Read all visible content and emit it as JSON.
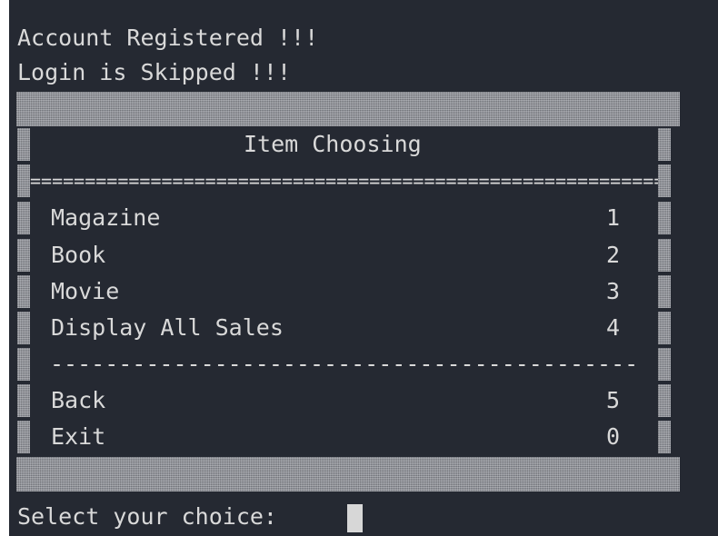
{
  "terminal": {
    "status_lines": [
      "Account Registered !!!",
      "Login is Skipped !!!"
    ],
    "menu": {
      "title": "Item Choosing",
      "separator_double": "=========================================================================",
      "separator_single": "--------------------------------------------------------------",
      "items": [
        {
          "label": "Magazine",
          "key": "1"
        },
        {
          "label": "Book",
          "key": "2"
        },
        {
          "label": "Movie",
          "key": "3"
        },
        {
          "label": "Display All Sales",
          "key": "4"
        }
      ],
      "nav_items": [
        {
          "label": "Back",
          "key": "5"
        },
        {
          "label": "Exit",
          "key": "0"
        }
      ]
    },
    "prompt": "Select your choice: ",
    "colors": {
      "background": "#252932",
      "text": "#d9d9d9",
      "frame": "#8f9299",
      "cursor": "#d7d7d7"
    }
  }
}
